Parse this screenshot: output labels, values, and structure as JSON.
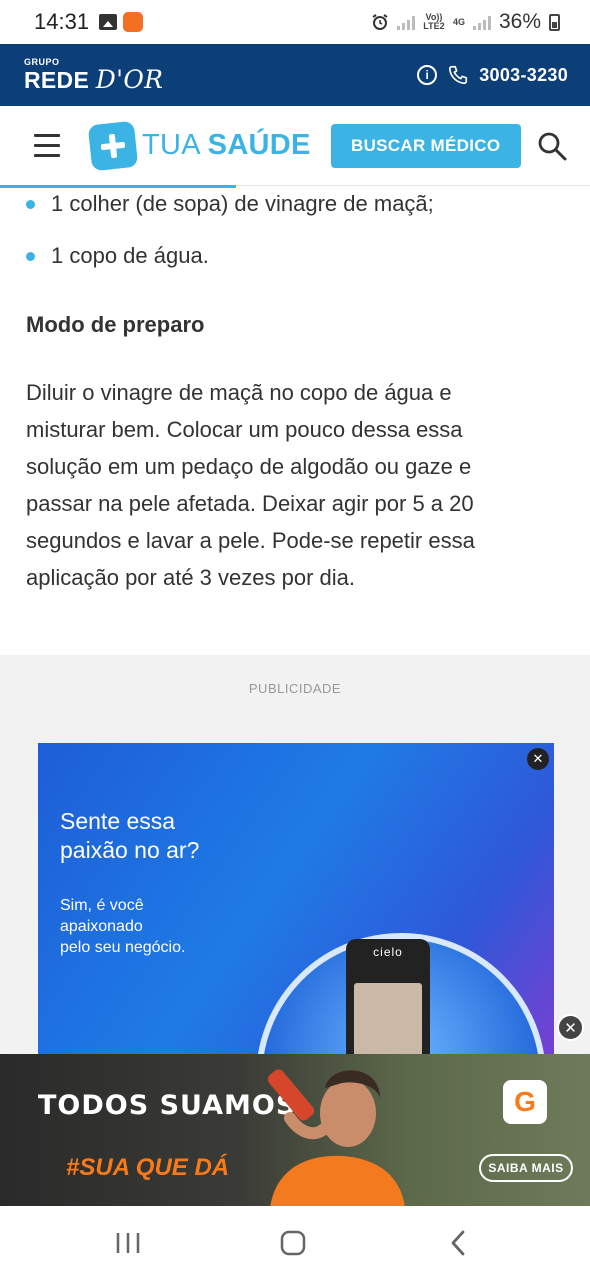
{
  "status_bar": {
    "time": "14:31",
    "battery": "36%",
    "network_label_top": "Vo)) LTE2",
    "network_label_mid": "4G"
  },
  "top_bar": {
    "grupo": "GRUPO",
    "brand_main": "REDE ",
    "brand_script": "D'OR",
    "phone": "3003-3230"
  },
  "nav": {
    "logo_thin": "TUA ",
    "logo_bold": "SAÚDE",
    "find_doctor": "BUSCAR MÉDICO"
  },
  "article": {
    "ingredients": [
      "1 colher (de sopa) de vinagre de maçã;",
      "1 copo de água."
    ],
    "section_heading": "Modo de preparo",
    "paragraph_lines": [
      "Diluir o vinagre de maçã no copo de água e",
      "misturar bem. Colocar um pouco dessa essa",
      "solução em um pedaço de algodão ou gaze e",
      "passar na pele afetada. Deixar agir por 5 a 20",
      "segundos e lavar a pele. Pode-se repetir essa",
      "aplicação por até 3 vezes por dia."
    ]
  },
  "ad": {
    "label": "PUBLICIDADE",
    "headline_lines": [
      "Sente essa",
      "paixão no ar?"
    ],
    "sub_lines": [
      "Sim, é você",
      "apaixonado",
      "pelo seu negócio."
    ],
    "device_brand": "cielo"
  },
  "sticky_ad": {
    "headline": "TODOS SUAMOS.",
    "tag": "#SUA QUE DÁ",
    "button": "SAIBA MAIS",
    "logo": "G"
  },
  "colors": {
    "brand_blue": "#3bb4e5",
    "rede_navy": "#0c3e78",
    "ad_orange": "#f97a1a"
  }
}
